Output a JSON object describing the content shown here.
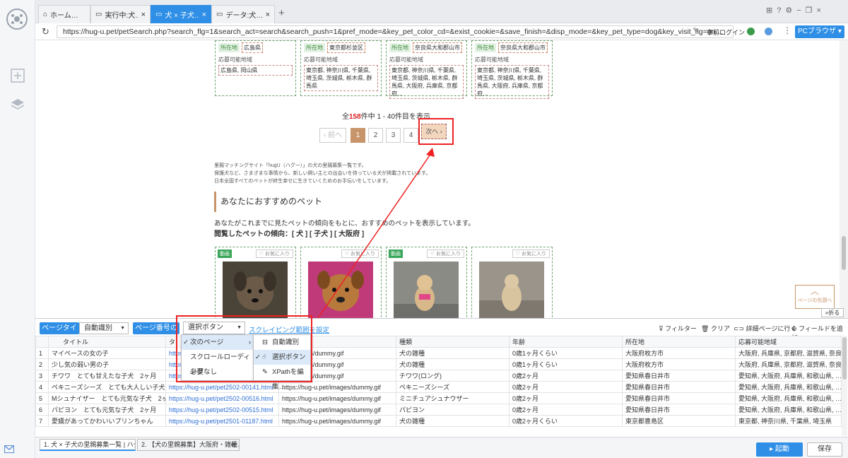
{
  "tabs": [
    {
      "label": "ホーム…"
    },
    {
      "label": "実行中:犬…"
    },
    {
      "label": "犬 × 子犬…"
    },
    {
      "label": "データ:犬…"
    }
  ],
  "address": {
    "url": "https://hug-u.pet/petSearch.php?search_flg=1&search_act=search&search_push=1&pref_mode=&key_pet_color_cd=&exist_cookie=&save_finish=&disp_mode=&key_pet_type=dog&key_visit_flg=on…",
    "login": "事前ログイン",
    "browser": "PCブラウザ"
  },
  "page": {
    "cards_top": [
      {
        "loc_label": "所在地",
        "loc": "広島県",
        "area_label": "応募可能地域",
        "area": "広島県, 岡山県"
      },
      {
        "loc_label": "所在地",
        "loc": "東京都杉並区",
        "area_label": "応募可能地域",
        "area": "東京都, 神奈川県, 千葉県, 埼玉県, 茨城県, 栃木県, 群馬県"
      },
      {
        "loc_label": "所在地",
        "loc": "奈良県大和郡山市",
        "area_label": "応募可能地域",
        "area": "東京都, 神奈川県, 千葉県, 埼玉県, 茨城県, 栃木県, 群馬県, 大阪府, 兵庫県, 京都府…"
      },
      {
        "loc_label": "所在地",
        "loc": "奈良県大和郡山市",
        "area_label": "応募可能地域",
        "area": "東京都, 神奈川県, 千葉県, 埼玉県, 茨城県, 栃木県, 群馬県, 大阪府, 兵庫県, 京都府…"
      }
    ],
    "count_prefix": "全",
    "count_num": "158",
    "count_suffix": "件中 1 - 40件目を表示",
    "pager": {
      "prev": "‹ 前へ",
      "p1": "1",
      "p2": "2",
      "p3": "3",
      "p4": "4",
      "next": "次へ ›"
    },
    "desc1": "里親マッチングサイト「hugU（ハグー）」の犬の里親募集一覧です。",
    "desc2": "保護犬など、さまざまな事情から、新しい飼い主との出会いを待っている犬が掲載されています。",
    "desc3": "日本全国すべてのペットが終生幸せに生きていくためのお手伝いをしています。",
    "rec_title": "あなたにおすすめのペット",
    "rec_desc": "あなたがこれまでに見たペットの傾向をもとに、おすすめのペットを表示しています。",
    "rec_trend": "閲覧したペットの傾向：[ 犬 ] [ 子犬 ] [ 大阪府 ]",
    "rec_cards": [
      {
        "badge": "動画",
        "fav": "♡ お気に入り"
      },
      {
        "badge": "",
        "fav": "♡ お気に入り"
      },
      {
        "badge": "動画",
        "fav": "♡ お気に入り"
      },
      {
        "badge": "",
        "fav": "♡ お気に入り"
      }
    ],
    "scroll_top": "ページの先頭へ"
  },
  "panel": {
    "fold": "折る",
    "page_type_label": "ページタイプ",
    "page_type_value": "自動識別",
    "pagination_label": "ページ番号の設定",
    "pagination_value": "選択ボタン",
    "scrape_range": "スクレイピング範囲を設定",
    "filter": "フィルター",
    "clear": "クリア",
    "detail": "詳細ページに行く",
    "add_field": "フィールドを追加",
    "menu1": [
      {
        "label": "次のページ"
      },
      {
        "label": "スクロールローディング"
      },
      {
        "label": "必要なし"
      }
    ],
    "menu2": [
      {
        "label": "自動識別"
      },
      {
        "label": "選択ボタン"
      },
      {
        "label": "XPathを編集…"
      }
    ],
    "columns": [
      "",
      "タイトル",
      "タ",
      "",
      "種類",
      "年齢",
      "所在地",
      "応募可能地域"
    ],
    "rows": [
      {
        "n": "1",
        "title": "マイペースの女の子",
        "link": "https:",
        "img": "pet/images/dummy.gif",
        "kind": "犬の雑種",
        "age": "0歳1ヶ月くらい",
        "loc": "大阪府枚方市",
        "area": "大阪府, 兵庫県, 京都府, 滋賀県, 奈良県"
      },
      {
        "n": "2",
        "title": "少し気の弱い男の子",
        "link": "https:",
        "img": "pet/images/dummy.gif",
        "kind": "犬の雑種",
        "age": "0歳1ヶ月くらい",
        "loc": "大阪府枚方市",
        "area": "大阪府, 兵庫県, 京都府, 滋賀県, 奈良県"
      },
      {
        "n": "3",
        "title": "チワワ　とても甘えたな子犬　2ヶ月",
        "link": "https:",
        "img": "pet/images/dummy.gif",
        "kind": "チワワ(ロング)",
        "age": "0歳2ヶ月",
        "loc": "愛知県春日井市",
        "area": "愛知県, 大阪府, 兵庫県, 和歌山県, …"
      },
      {
        "n": "4",
        "title": "ペキニーズシーズ　とても大人しい子犬　…",
        "link": "https://hug-u.pet/pet2502-00141.html",
        "img": "https://hug-u.pet/images/dummy.gif",
        "kind": "ペキニーズシーズ",
        "age": "0歳2ヶ月",
        "loc": "愛知県春日井市",
        "area": "愛知県, 大阪府, 兵庫県, 和歌山県, …"
      },
      {
        "n": "5",
        "title": "Mシュナイザー　とても元気な子犬　2ヶ月",
        "link": "https://hug-u.pet/pet2502-00516.html",
        "img": "https://hug-u.pet/images/dummy.gif",
        "kind": "ミニチュアシュナウザー",
        "age": "0歳2ヶ月",
        "loc": "愛知県春日井市",
        "area": "愛知県, 大阪府, 兵庫県, 和歌山県, …"
      },
      {
        "n": "6",
        "title": "パピヨン　とても元気な子犬　2ヶ月",
        "link": "https://hug-u.pet/pet2502-00515.html",
        "img": "https://hug-u.pet/images/dummy.gif",
        "kind": "パピヨン",
        "age": "0歳2ヶ月",
        "loc": "愛知県春日井市",
        "area": "愛知県, 大阪府, 兵庫県, 和歌山県, …"
      },
      {
        "n": "7",
        "title": "愛嬌があってかわいいプリンちゃん",
        "link": "https://hug-u.pet/pet2501-01187.html",
        "img": "https://hug-u.pet/images/dummy.gif",
        "kind": "犬の雑種",
        "age": "0歳2ヶ月くらい",
        "loc": "東京都豊島区",
        "area": "東京都, 神奈川県, 千葉県, 埼玉県"
      }
    ]
  },
  "bottom": {
    "tab1": "1. 犬 × 子犬の里親募集一覧 | ハグ…",
    "tab2": "2. 【犬の里親募集】大阪府・雑種…",
    "start": "▸ 起動",
    "save": "保存"
  },
  "colors": {
    "accent": "#2f8fe6",
    "highlight": "#e22222",
    "orange": "#c8956a"
  }
}
